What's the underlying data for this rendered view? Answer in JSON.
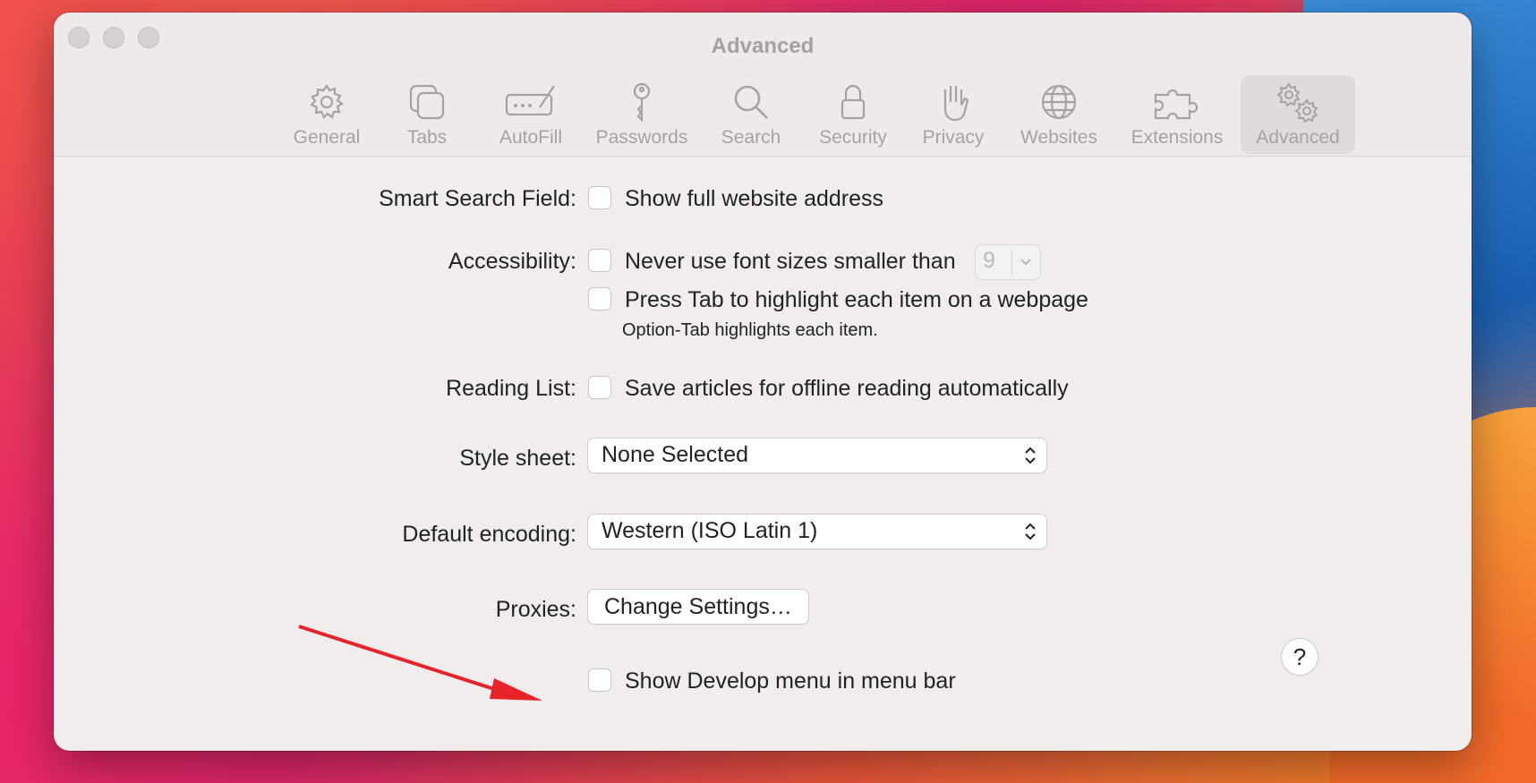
{
  "window": {
    "title": "Advanced"
  },
  "toolbar": {
    "items": [
      {
        "label": "General",
        "icon": "gear-icon"
      },
      {
        "label": "Tabs",
        "icon": "tabs-icon"
      },
      {
        "label": "AutoFill",
        "icon": "autofill-icon"
      },
      {
        "label": "Passwords",
        "icon": "key-icon"
      },
      {
        "label": "Search",
        "icon": "search-icon"
      },
      {
        "label": "Security",
        "icon": "lock-icon"
      },
      {
        "label": "Privacy",
        "icon": "hand-icon"
      },
      {
        "label": "Websites",
        "icon": "globe-icon"
      },
      {
        "label": "Extensions",
        "icon": "puzzle-icon"
      },
      {
        "label": "Advanced",
        "icon": "gears-icon",
        "selected": true
      }
    ]
  },
  "settings": {
    "smart_search": {
      "label": "Smart Search Field:",
      "checkbox_label": "Show full website address",
      "checked": false
    },
    "accessibility": {
      "label": "Accessibility:",
      "font_size_label": "Never use font sizes smaller than",
      "font_size_checked": false,
      "font_size_value": "9",
      "tab_label": "Press Tab to highlight each item on a webpage",
      "tab_checked": false,
      "tab_hint": "Option-Tab highlights each item."
    },
    "reading_list": {
      "label": "Reading List:",
      "checkbox_label": "Save articles for offline reading automatically",
      "checked": false
    },
    "style_sheet": {
      "label": "Style sheet:",
      "value": "None Selected"
    },
    "default_encoding": {
      "label": "Default encoding:",
      "value": "Western (ISO Latin 1)"
    },
    "proxies": {
      "label": "Proxies:",
      "button_label": "Change Settings…"
    },
    "develop_menu": {
      "checkbox_label": "Show Develop menu in menu bar",
      "checked": false
    }
  },
  "help": {
    "label": "?"
  },
  "colors": {
    "annotation_arrow": "#e8232a",
    "window_bg": "#f2eded",
    "toolbar_text": "#a7a2a2"
  }
}
